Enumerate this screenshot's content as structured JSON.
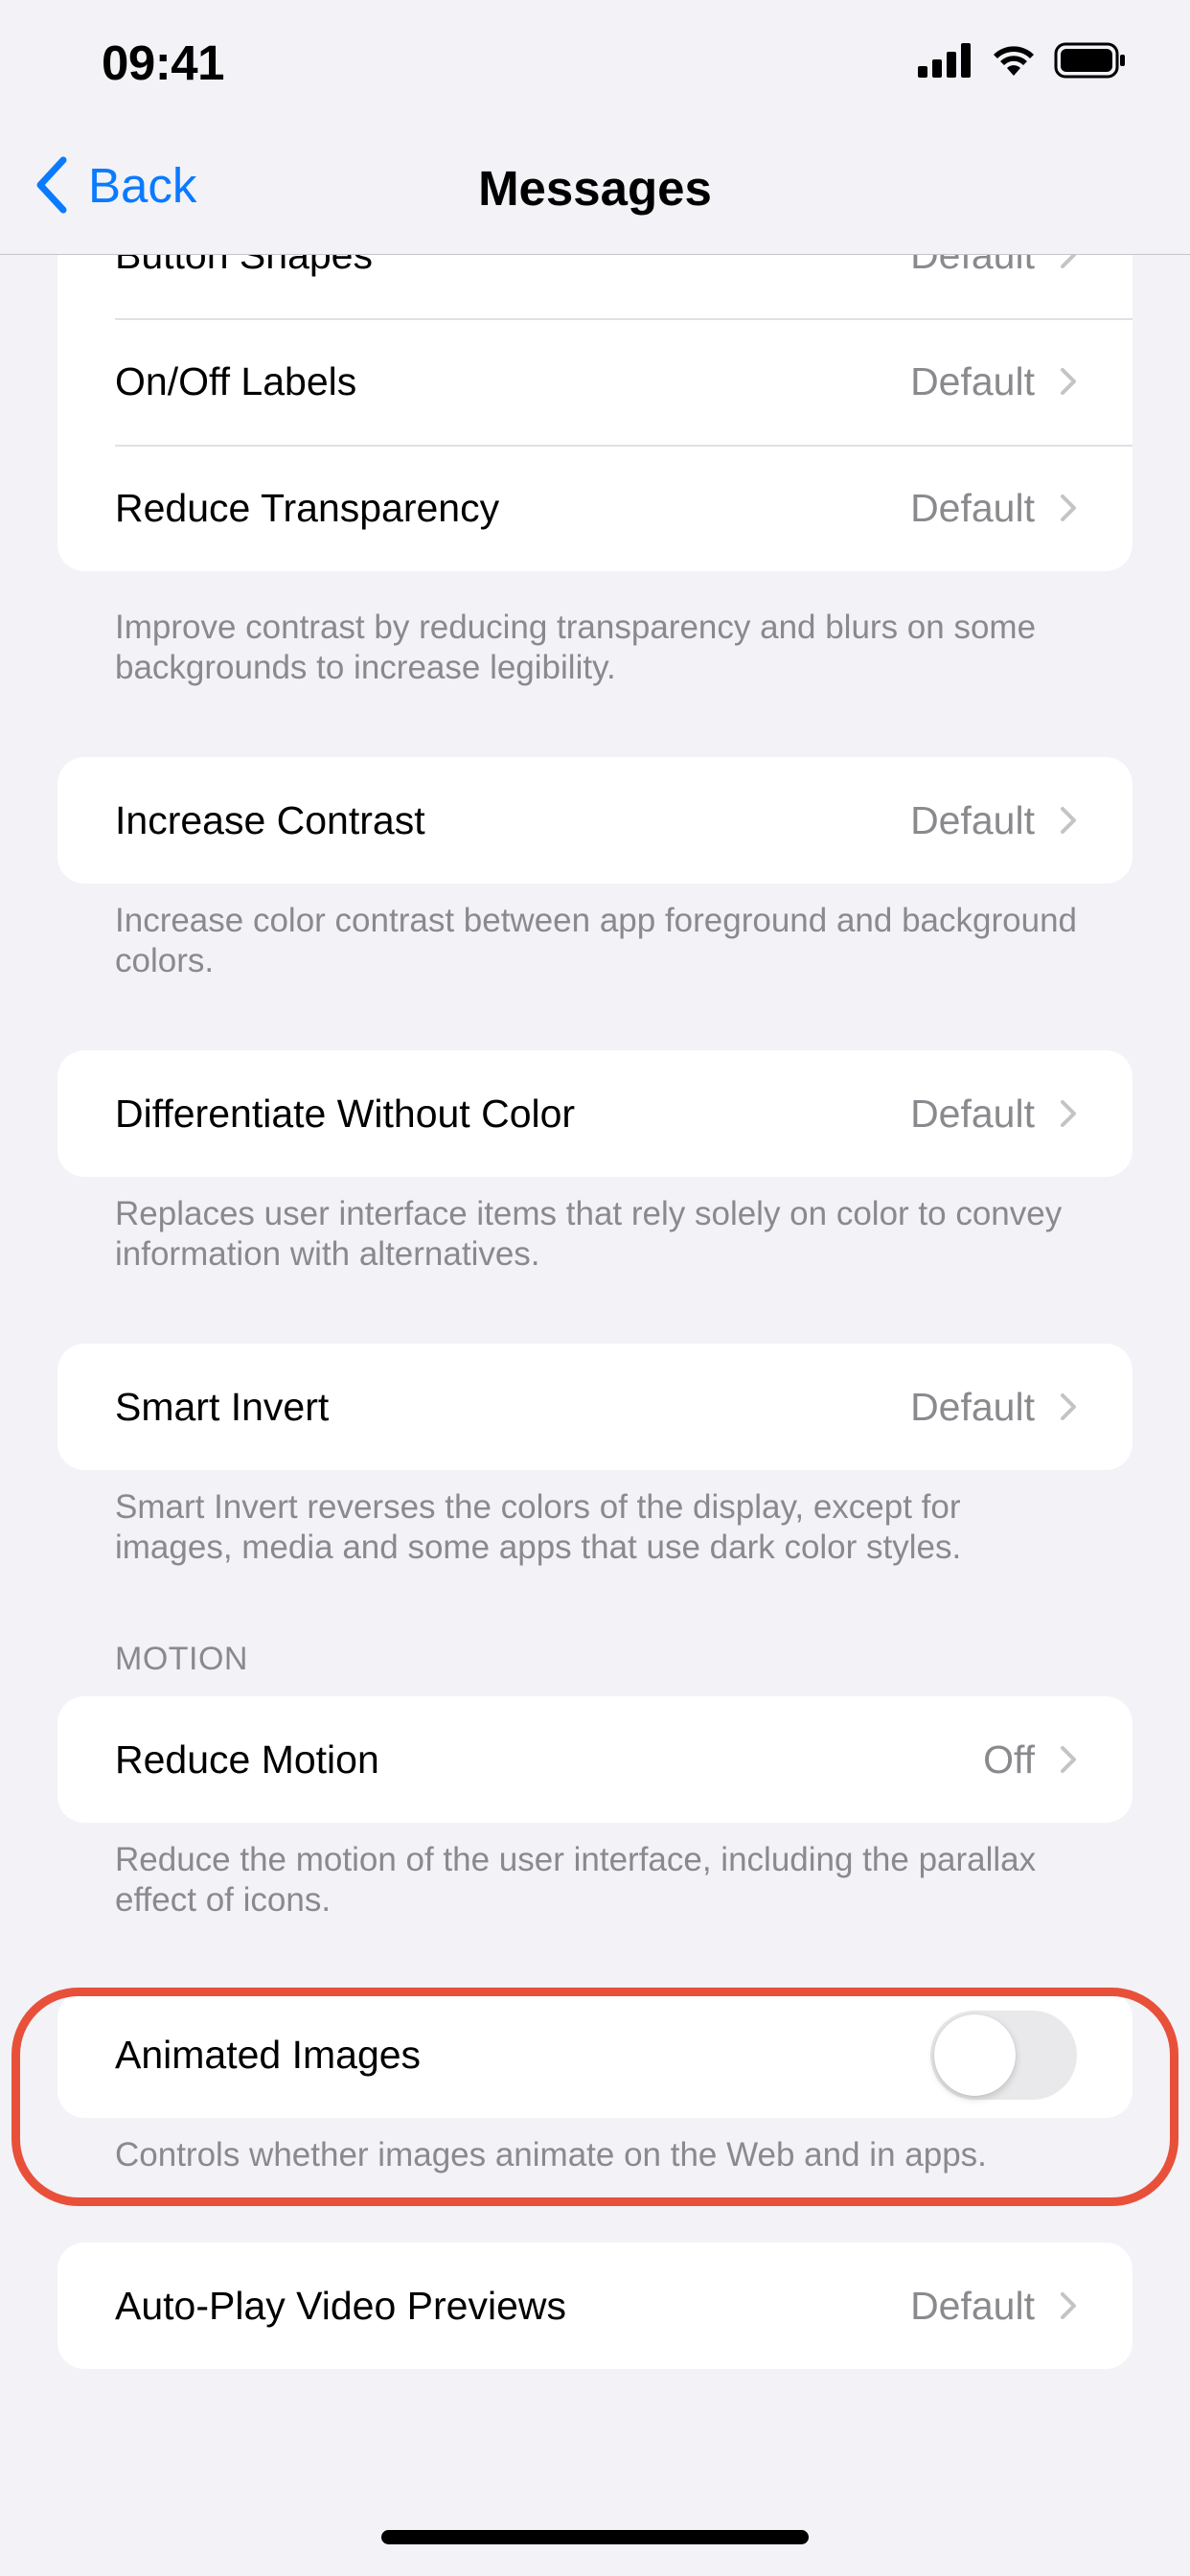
{
  "status_bar": {
    "time": "09:41"
  },
  "nav": {
    "back_label": "Back",
    "title": "Messages"
  },
  "groups": {
    "display": {
      "rows": [
        {
          "label": "Button Shapes",
          "value": "Default"
        },
        {
          "label": "On/Off Labels",
          "value": "Default"
        },
        {
          "label": "Reduce Transparency",
          "value": "Default"
        }
      ],
      "footnote": "Improve contrast by reducing transparency and blurs on some backgrounds to increase legibility."
    },
    "increase_contrast": {
      "label": "Increase Contrast",
      "value": "Default",
      "footnote": "Increase color contrast between app foreground and background colors."
    },
    "differentiate": {
      "label": "Differentiate Without Color",
      "value": "Default",
      "footnote": "Replaces user interface items that rely solely on color to convey information with alternatives."
    },
    "smart_invert": {
      "label": "Smart Invert",
      "value": "Default",
      "footnote": "Smart Invert reverses the colors of the display, except for images, media and some apps that use dark color styles."
    },
    "motion_header": "MOTION",
    "reduce_motion": {
      "label": "Reduce Motion",
      "value": "Off",
      "footnote": "Reduce the motion of the user interface, including the parallax effect of icons."
    },
    "animated_images": {
      "label": "Animated Images",
      "toggle_on": false,
      "footnote": "Controls whether images animate on the Web and in apps."
    },
    "autoplay": {
      "label": "Auto-Play Video Previews",
      "value": "Default"
    }
  },
  "colors": {
    "accent": "#0a7aff",
    "highlight": "#e8503a",
    "background": "#f2f2f7"
  }
}
